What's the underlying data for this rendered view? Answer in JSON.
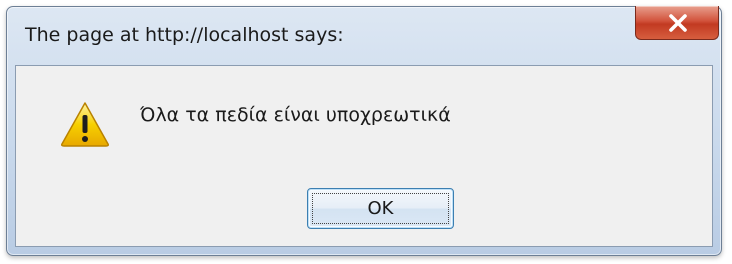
{
  "dialog": {
    "title": "The page at http://localhost says:",
    "message": "Όλα τα πεδία είναι υποχρεωτικά",
    "ok_label": "OK",
    "icon": "warning-icon",
    "close_icon": "close-icon"
  },
  "colors": {
    "close_button": "#c9452b",
    "warning_yellow": "#f3c300",
    "ok_border": "#3c7fb1"
  }
}
